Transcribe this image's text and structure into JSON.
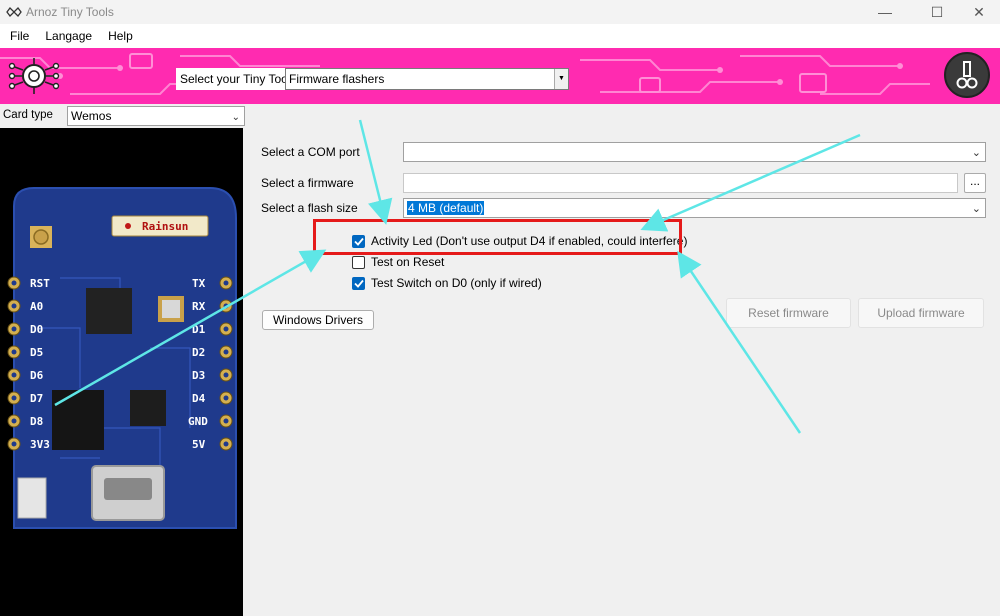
{
  "window": {
    "title": "Arnoz Tiny Tools",
    "minimize_glyph": "—",
    "maximize_glyph": "☐",
    "close_glyph": "✕"
  },
  "menu": {
    "items": [
      "File",
      "Langage",
      "Help"
    ]
  },
  "banner": {
    "tool_label": "Select your Tiny Tool",
    "tool_value": "Firmware flashers",
    "background_color": "#ff2bb0"
  },
  "left_panel": {
    "card_type_label": "Card type",
    "card_type_value": "Wemos",
    "board_brand": "Rainsun",
    "pins_left": [
      "RST",
      "A0",
      "D0",
      "D5",
      "D6",
      "D7",
      "D8",
      "3V3"
    ],
    "pins_right": [
      "TX",
      "RX",
      "D1",
      "D2",
      "D3",
      "D4",
      "GND",
      "5V"
    ]
  },
  "form": {
    "com_port_label": "Select a COM port",
    "com_port_value": "",
    "firmware_label": "Select a firmware",
    "firmware_value": "",
    "browse_label": "...",
    "flash_size_label": "Select a flash size",
    "flash_size_value": "4 MB (default)"
  },
  "options": {
    "activity_led": {
      "label": "Activity Led (Don't use output D4 if enabled, could interfere)",
      "checked": true
    },
    "test_on_reset": {
      "label": "Test on Reset",
      "checked": false
    },
    "test_switch": {
      "label": "Test Switch on D0 (only if wired)",
      "checked": true
    }
  },
  "buttons": {
    "windows_drivers": "Windows Drivers",
    "reset_firmware": "Reset firmware",
    "upload_firmware": "Upload firmware"
  },
  "annotation": {
    "highlight_color": "#e51a1a",
    "arrow_color": "#5ee6e6"
  }
}
